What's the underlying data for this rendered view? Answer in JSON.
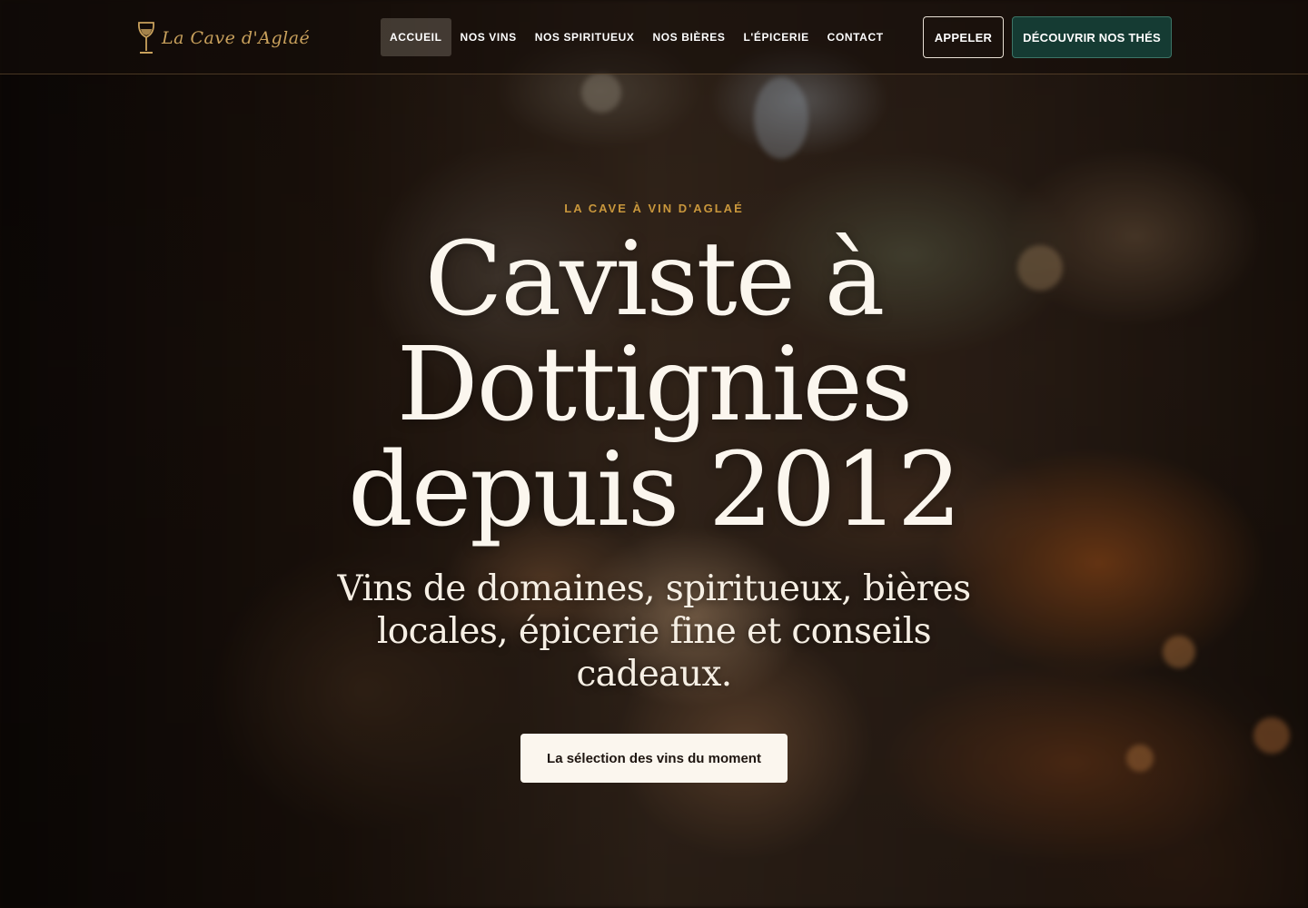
{
  "brand": {
    "logo_text": "La Cave d'Aglaé",
    "accent_color": "#c9a15c"
  },
  "nav": {
    "items": [
      {
        "label": "ACCUEIL",
        "active": true
      },
      {
        "label": "NOS VINS",
        "active": false
      },
      {
        "label": "NOS SPIRITUEUX",
        "active": false
      },
      {
        "label": "NOS BIÈRES",
        "active": false
      },
      {
        "label": "L'ÉPICERIE",
        "active": false
      },
      {
        "label": "CONTACT",
        "active": false
      }
    ]
  },
  "header_actions": {
    "call_label": "APPELER",
    "tea_label": "DÉCOUVRIR NOS THÉS",
    "tea_color": "#153b33"
  },
  "hero": {
    "eyebrow": "LA CAVE À VIN D'AGLAÉ",
    "eyebrow_color": "#c9973c",
    "headline_lines": [
      "Caviste à",
      "Dottignies",
      "depuis 2012"
    ],
    "subline": "Vins de domaines, spiritueux, bières locales, épicerie fine et conseils cadeaux.",
    "cta_label": "La sélection des vins du moment"
  }
}
